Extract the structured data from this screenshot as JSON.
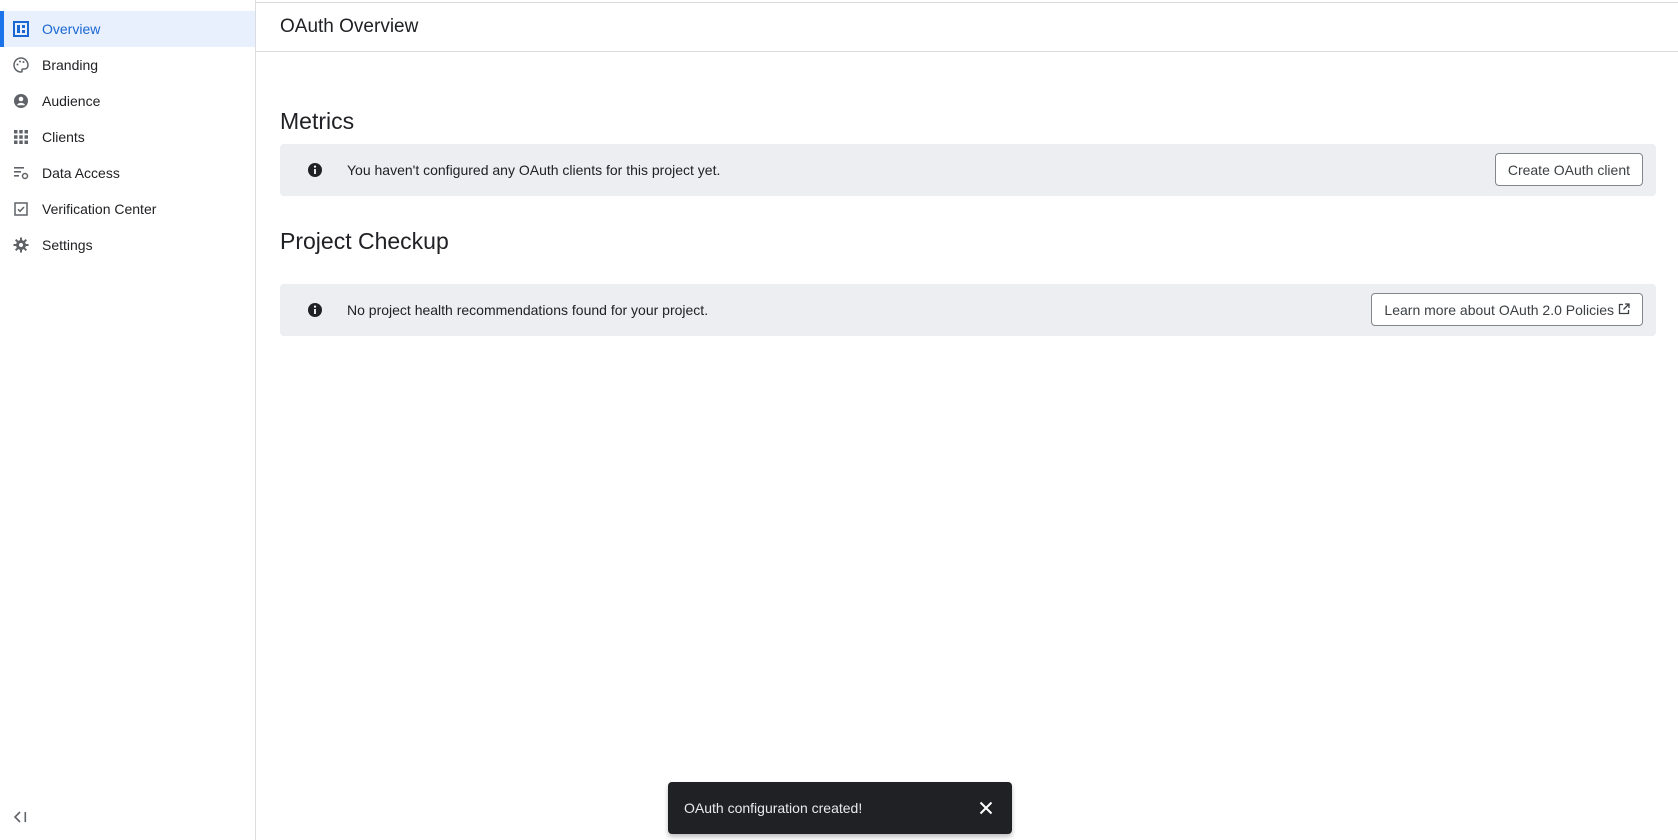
{
  "sidebar": {
    "items": [
      {
        "label": "Overview",
        "icon": "dashboard-icon",
        "active": true
      },
      {
        "label": "Branding",
        "icon": "palette-icon"
      },
      {
        "label": "Audience",
        "icon": "account-circle-icon"
      },
      {
        "label": "Clients",
        "icon": "apps-grid-icon"
      },
      {
        "label": "Data Access",
        "icon": "tune-list-icon"
      },
      {
        "label": "Verification Center",
        "icon": "check-box-icon"
      },
      {
        "label": "Settings",
        "icon": "gear-icon"
      }
    ],
    "collapse_icon": "collapse-left-icon"
  },
  "header": {
    "title": "OAuth Overview"
  },
  "metrics": {
    "title": "Metrics",
    "banner_text": "You haven't configured any OAuth clients for this project yet.",
    "button_label": "Create OAuth client"
  },
  "checkup": {
    "title": "Project Checkup",
    "banner_text": "No project health recommendations found for your project.",
    "button_label": "Learn more about OAuth 2.0 Policies"
  },
  "snackbar": {
    "text": "OAuth configuration created!"
  },
  "colors": {
    "accent": "#1a73e8",
    "active_bg": "#e8f0fe",
    "banner_bg": "#eceef1",
    "snackbar_bg": "#202124"
  }
}
